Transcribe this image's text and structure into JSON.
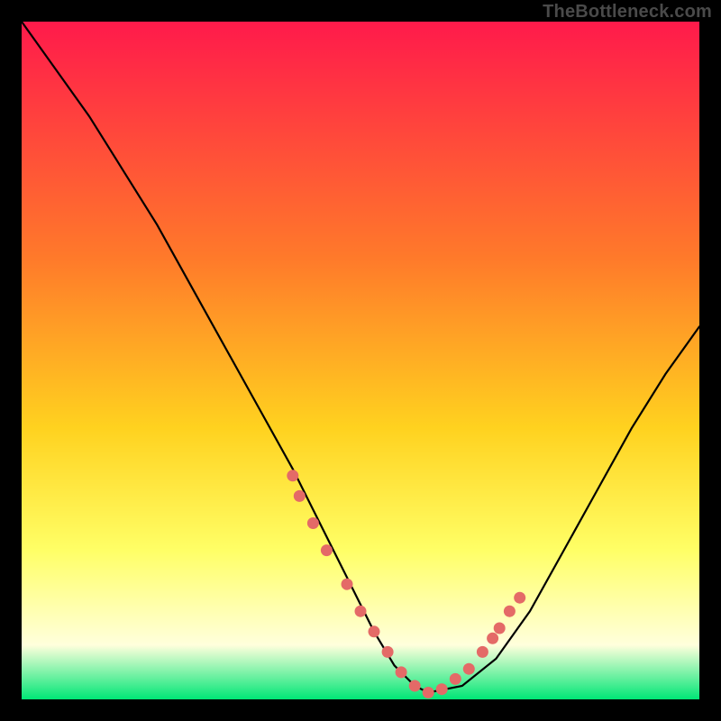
{
  "watermark": "TheBottleneck.com",
  "colors": {
    "gradient_top": "#ff1a4b",
    "gradient_mid1": "#ff7a2a",
    "gradient_mid2": "#ffd21f",
    "gradient_mid3": "#ffff66",
    "gradient_mid4": "#ffffdc",
    "gradient_bottom": "#00e676",
    "curve": "#000000",
    "marker": "#e46a67",
    "frame": "#000000"
  },
  "chart_data": {
    "type": "line",
    "title": "",
    "xlabel": "",
    "ylabel": "",
    "xlim": [
      0,
      100
    ],
    "ylim": [
      0,
      100
    ],
    "grid": false,
    "series": [
      {
        "name": "bottleneck-curve",
        "x": [
          0,
          5,
          10,
          15,
          20,
          25,
          30,
          35,
          40,
          45,
          50,
          52,
          55,
          58,
          60,
          65,
          70,
          75,
          80,
          85,
          90,
          95,
          100
        ],
        "y": [
          100,
          93,
          86,
          78,
          70,
          61,
          52,
          43,
          34,
          24,
          14,
          10,
          5,
          2,
          1,
          2,
          6,
          13,
          22,
          31,
          40,
          48,
          55
        ]
      }
    ],
    "markers": {
      "name": "highlight-dots",
      "x": [
        40,
        41,
        43,
        45,
        48,
        50,
        52,
        54,
        56,
        58,
        60,
        62,
        64,
        66,
        68,
        69.5,
        70.5,
        72,
        73.5
      ],
      "y": [
        33,
        30,
        26,
        22,
        17,
        13,
        10,
        7,
        4,
        2,
        1,
        1.5,
        3,
        4.5,
        7,
        9,
        10.5,
        13,
        15
      ]
    }
  }
}
